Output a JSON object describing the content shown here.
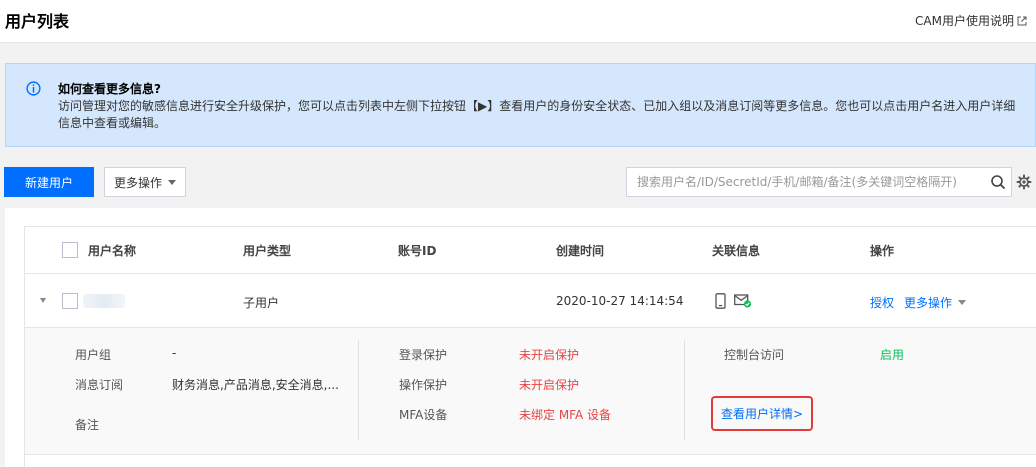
{
  "header": {
    "title": "用户列表",
    "doc_link": "CAM用户使用说明"
  },
  "info": {
    "title": "如何查看更多信息?",
    "text": "访问管理对您的敏感信息进行安全升级保护，您可以点击列表中左侧下拉按钮【▶】查看用户的身份安全状态、已加入组以及消息订阅等更多信息。您也可以点击用户名进入用户详细信息中查看或编辑。"
  },
  "toolbar": {
    "new_user_label": "新建用户",
    "more_actions_label": "更多操作",
    "search_placeholder": "搜索用户名/ID/SecretId/手机/邮箱/备注(多关键词空格隔开)"
  },
  "table": {
    "headers": {
      "username": "用户名称",
      "user_type": "用户类型",
      "account_id": "账号ID",
      "created_time": "创建时间",
      "linked_info": "关联信息",
      "actions": "操作"
    },
    "row": {
      "username": "",
      "user_type": "子用户",
      "account_id": "",
      "created_time": "2020-10-27 14:14:54",
      "action_authorize": "授权",
      "action_more": "更多操作"
    },
    "detail": {
      "group_label": "用户组",
      "group_value": "-",
      "subscription_label": "消息订阅",
      "subscription_value": "财务消息,产品消息,安全消息,...",
      "remark_label": "备注",
      "login_protect_label": "登录保护",
      "login_protect_value": "未开启保护",
      "op_protect_label": "操作保护",
      "op_protect_value": "未开启保护",
      "mfa_label": "MFA设备",
      "mfa_value": "未绑定 MFA 设备",
      "console_label": "控制台访问",
      "console_value": "启用",
      "view_detail_link": "查看用户详情>"
    }
  },
  "colors": {
    "primary": "#006eff",
    "danger": "#e54545",
    "success": "#0abf5b",
    "info_bg": "#d5e7fd"
  }
}
